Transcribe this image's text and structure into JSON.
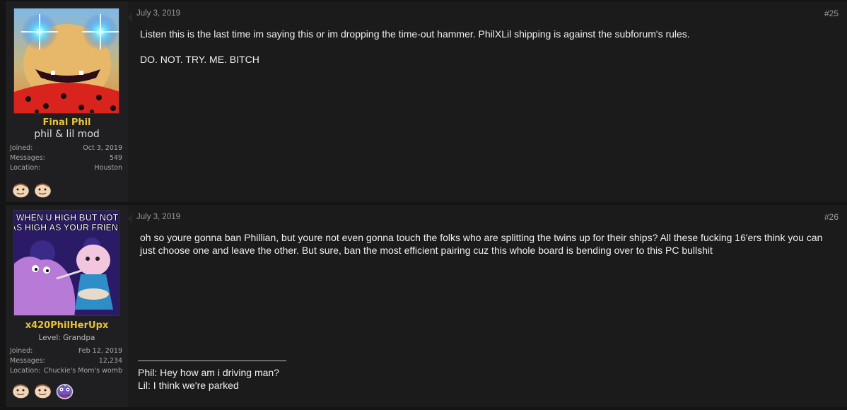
{
  "posts": [
    {
      "date": "July 3, 2019",
      "number": "#25",
      "user": {
        "name": "Final Phil",
        "title": "phil & lil mod",
        "stats": [
          {
            "label": "Joined:",
            "value": "Oct 3, 2019"
          },
          {
            "label": "Messages:",
            "value": "549"
          },
          {
            "label": "Location:",
            "value": "Houston"
          }
        ],
        "trophies": [
          "baby-face-icon",
          "baby-face-icon"
        ]
      },
      "body": [
        "Listen this is the last time im saying this or im dropping the time-out hammer. PhilXLil shipping is against the subforum's rules.",
        "DO. NOT. TRY. ME. BITCH"
      ]
    },
    {
      "date": "July 3, 2019",
      "number": "#26",
      "user": {
        "name": "x420PhilHerUpx",
        "title": "Level: Grandpa",
        "avatar_caption": "WHEN U HIGH BUT NOT AS HIGH AS YOUR FRIEND",
        "stats": [
          {
            "label": "Joined:",
            "value": "Feb 12, 2019"
          },
          {
            "label": "Messages:",
            "value": "12,234"
          },
          {
            "label": "Location:",
            "value": "Chuckie's Mom's womb"
          }
        ],
        "trophies": [
          "baby-face-icon",
          "baby-face-icon",
          "reptar-head-icon"
        ]
      },
      "body": [
        "oh so youre gonna ban Phillian, but youre not even gonna touch the folks who are splitting the twins up for their ships? All these fucking 16'ers think you can just choose one and leave the other. But sure, ban the most efficient pairing cuz this whole board is bending over to this PC bullshit"
      ],
      "signature": [
        "Phil: Hey how am i driving man?",
        "Lil: I think we're parked"
      ]
    }
  ],
  "colors": {
    "page_bg": "#141414",
    "post_bg": "#1b1b1c",
    "user_bg": "#1f1f21",
    "username": "#e8c33a"
  }
}
